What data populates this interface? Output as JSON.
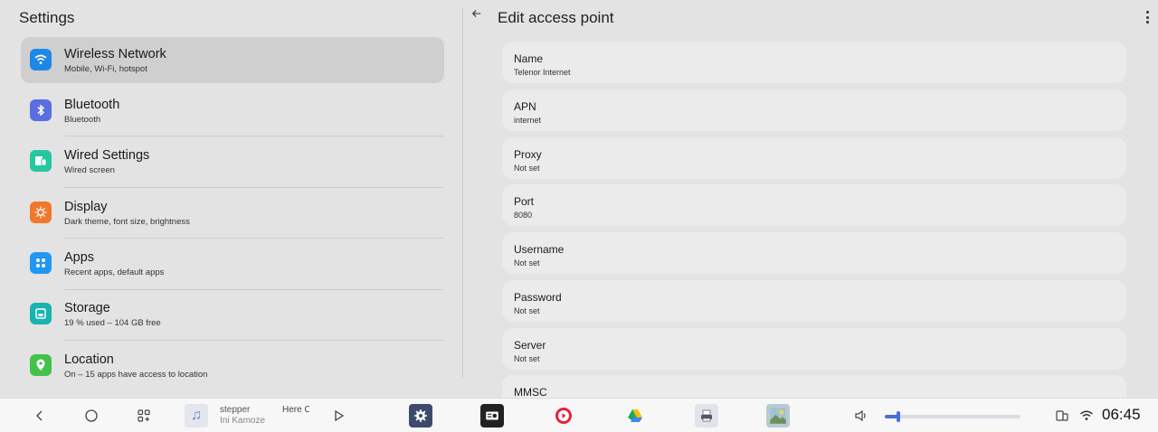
{
  "left_pane": {
    "title": "Settings",
    "items": [
      {
        "title": "Wireless Network",
        "subtitle": "Mobile, Wi-Fi, hotspot",
        "icon": "wifi-icon",
        "color": "#1e88e5"
      },
      {
        "title": "Bluetooth",
        "subtitle": "Bluetooth",
        "icon": "bluetooth-icon",
        "color": "#5b6ee1"
      },
      {
        "title": "Wired Settings",
        "subtitle": "Wired screen",
        "icon": "wired-screen-icon",
        "color": "#26c6a0"
      },
      {
        "title": "Display",
        "subtitle": "Dark theme, font size, brightness",
        "icon": "brightness-icon",
        "color": "#f0782c"
      },
      {
        "title": "Apps",
        "subtitle": "Recent apps, default apps",
        "icon": "apps-grid-icon",
        "color": "#2196f3"
      },
      {
        "title": "Storage",
        "subtitle": "19 % used – 104 GB free",
        "icon": "storage-icon",
        "color": "#19b3b0"
      },
      {
        "title": "Location",
        "subtitle": "On – 15 apps have access to location",
        "icon": "location-pin-icon",
        "color": "#43c24a"
      }
    ],
    "selected_index": 0
  },
  "right_pane": {
    "title": "Edit access point",
    "fields": [
      {
        "label": "Name",
        "value": "Telenor Internet"
      },
      {
        "label": "APN",
        "value": "internet"
      },
      {
        "label": "Proxy",
        "value": "Not set"
      },
      {
        "label": "Port",
        "value": "8080"
      },
      {
        "label": "Username",
        "value": "Not set"
      },
      {
        "label": "Password",
        "value": "Not set"
      },
      {
        "label": "Server",
        "value": "Not set"
      },
      {
        "label": "MMSC",
        "value": ""
      }
    ]
  },
  "taskbar": {
    "media": {
      "title": "stepper",
      "artist": "Ini Kamoze",
      "next": "Here C"
    },
    "apps": [
      "settings-icon",
      "radio-icon",
      "music-player-icon",
      "google-drive-icon",
      "printer-icon",
      "gallery-icon"
    ],
    "volume_level": 0.1,
    "clock": "06:45"
  },
  "colors": {
    "accent": "#4a6fd4",
    "selected_bg": "#cfcfcf"
  }
}
